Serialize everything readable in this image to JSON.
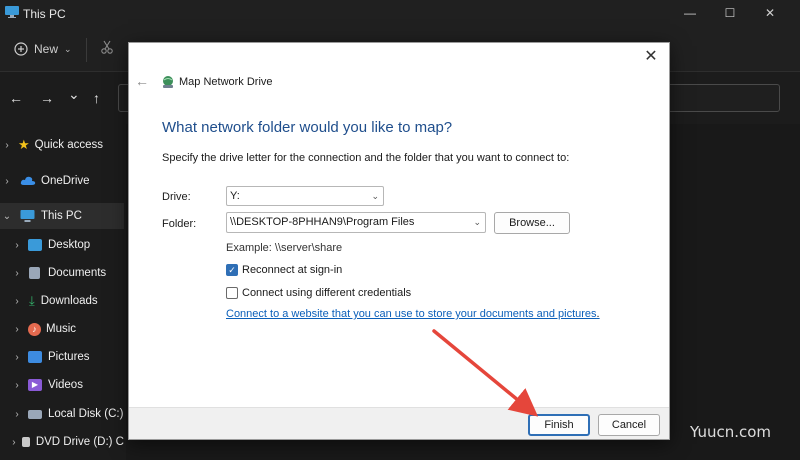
{
  "window": {
    "title": "This PC",
    "controls": {
      "minimize": "—",
      "maximize": "☐",
      "close": "✕"
    }
  },
  "toolbar": {
    "new_label": "New",
    "new_icon": "plus-circle-icon",
    "cut_icon": "scissors-icon"
  },
  "navigation": {
    "back": "←",
    "forward": "→",
    "recent": "⌄",
    "up": "↑"
  },
  "sidebar": {
    "items": [
      {
        "label": "Quick access",
        "icon": "star-icon",
        "color": "#f2c21b"
      },
      {
        "label": "OneDrive",
        "icon": "cloud-icon",
        "color": "#3a8ee6"
      },
      {
        "label": "This PC",
        "icon": "monitor-icon",
        "color": "#3a9ad9",
        "selected": true
      },
      {
        "label": "Desktop",
        "icon": "desktop-icon",
        "color": "#3a9ad9"
      },
      {
        "label": "Documents",
        "icon": "document-icon",
        "color": "#9aa7b8"
      },
      {
        "label": "Downloads",
        "icon": "download-icon",
        "color": "#33b36b"
      },
      {
        "label": "Music",
        "icon": "music-icon",
        "color": "#e46a4f"
      },
      {
        "label": "Pictures",
        "icon": "pictures-icon",
        "color": "#3d8be0"
      },
      {
        "label": "Videos",
        "icon": "videos-icon",
        "color": "#8a5ad6"
      },
      {
        "label": "Local Disk (C:)",
        "icon": "disk-icon",
        "color": "#9aa7b8"
      },
      {
        "label": "DVD Drive (D:) C",
        "icon": "dvd-icon",
        "color": "#c9c9c9"
      }
    ]
  },
  "dialog": {
    "title": "Map Network Drive",
    "close_glyph": "✕",
    "back_glyph": "←",
    "heading": "What network folder would you like to map?",
    "description": "Specify the drive letter for the connection and the folder that you want to connect to:",
    "drive_label": "Drive:",
    "drive_value": "Y:",
    "folder_label": "Folder:",
    "folder_value": "\\\\DESKTOP-8PHHAN9\\Program Files",
    "browse_label": "Browse...",
    "example": "Example: \\\\server\\share",
    "reconnect_label": "Reconnect at sign-in",
    "reconnect_checked": true,
    "credentials_label": "Connect using different credentials",
    "credentials_checked": false,
    "link_text": "Connect to a website that you can use to store your documents and pictures",
    "link_suffix": ".",
    "finish_label": "Finish",
    "cancel_label": "Cancel",
    "accent": "#2f6fb6"
  },
  "watermark": "Yuucn.com"
}
